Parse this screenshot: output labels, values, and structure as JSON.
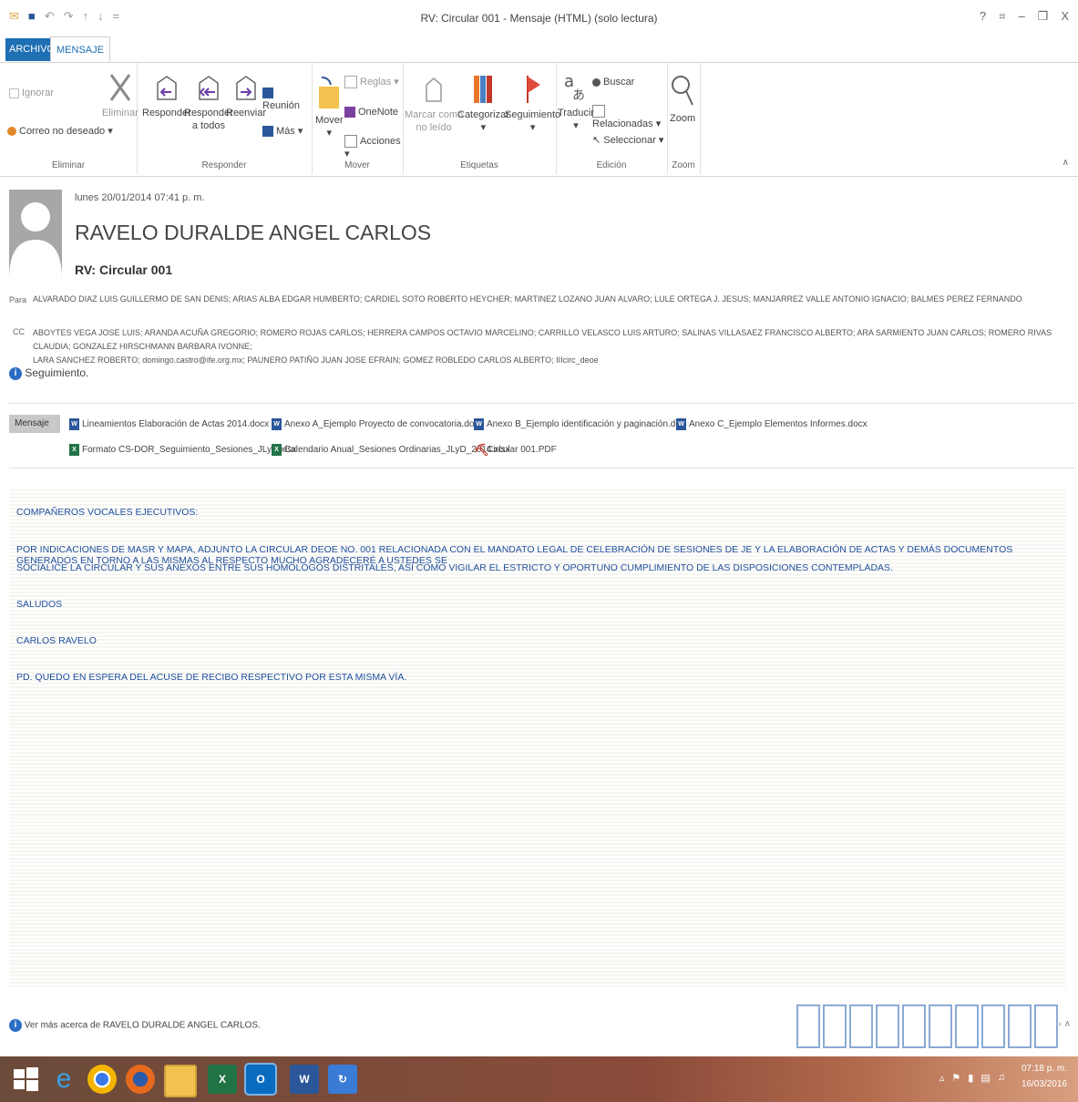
{
  "window": {
    "title": "RV: Circular 001 - Mensaje (HTML) (solo lectura)"
  },
  "qat": [
    "✉",
    "■",
    "↶",
    "↷",
    "↑",
    "↓",
    "="
  ],
  "winctl": [
    "?",
    "⌗",
    "–",
    "❐",
    "X"
  ],
  "tabs": {
    "archivo": "ARCHIVO",
    "mensaje": "MENSAJE"
  },
  "ribbon": {
    "groups": {
      "eliminar": "Eliminar",
      "responder": "Responder",
      "mover": "Mover",
      "etiquetas": "Etiquetas",
      "edicion": "Edición",
      "zoom": "Zoom"
    },
    "ignorar": "Ignorar",
    "correo_no_deseado": "Correo no deseado",
    "eliminar": "Eliminar",
    "responder": "Responder",
    "responder_todos_1": "Responder",
    "responder_todos_2": "a todos",
    "reenviar": "Reenviar",
    "reunion": "Reunión",
    "mas": "Más",
    "mover": "Mover",
    "reglas": "Reglas",
    "onenote": "OneNote",
    "acciones": "Acciones",
    "marcar_1": "Marcar como",
    "marcar_2": "no leído",
    "categorizar": "Categorizar",
    "seguimiento": "Seguimiento",
    "traducir": "Traducir",
    "buscar": "Buscar",
    "relacionadas": "Relacionadas",
    "seleccionar": "Seleccionar",
    "zoom": "Zoom"
  },
  "header": {
    "date": "lunes 20/01/2014 07:41 p. m.",
    "sender": "RAVELO DURALDE ANGEL CARLOS",
    "subject": "RV: Circular 001",
    "para_label": "Para",
    "para": "ALVARADO DIAZ LUIS GUILLERMO DE SAN DENIS; ARIAS ALBA EDGAR HUMBERTO; CARDIEL SOTO ROBERTO HEYCHER; MARTINEZ LOZANO JUAN ALVARO; LULE ORTEGA J. JESUS; MANJARREZ VALLE ANTONIO IGNACIO; BALMES PEREZ FERNANDO",
    "cc_label": "CC",
    "cc_1": "ABOYTES VEGA JOSE LUIS; ARANDA ACUÑA GREGORIO; ROMERO ROJAS CARLOS; HERRERA CAMPOS OCTAVIO MARCELINO; CARRILLO VELASCO LUIS ARTURO; SALINAS VILLASAEZ FRANCISCO ALBERTO; ARA SARMIENTO JUAN CARLOS; ROMERO RIVAS CLAUDIA; GONZALEZ HIRSCHMANN BARBARA IVONNE;",
    "cc_2": "LARA SANCHEZ ROBERTO; domingo.castro@ife.org.mx; PAUNERO PATIÑO JUAN JOSE EFRAIN; GOMEZ ROBLEDO CARLOS ALBERTO; IIIcirc_deoe",
    "seguimiento": "Seguimiento."
  },
  "attachments": {
    "mensaje": "Mensaje",
    "a1": "Lineamientos Elaboración de Actas 2014.docx",
    "a2": "Anexo A_Ejemplo Proyecto de convocatoria.docx",
    "a3": "Anexo B_Ejemplo identificación y paginación.doc",
    "a4": "Anexo C_Ejemplo Elementos Informes.docx",
    "a5": "Formato CS-DOR_Seguimiento_Sesiones_JLyD.xlsx",
    "a6": "Calendario Anual_Sesiones Ordinarias_JLyD_2014.xlsx",
    "a7": "Circular 001.PDF"
  },
  "body": {
    "greeting": "COMPAÑEROS VOCALES EJECUTIVOS:",
    "p1_line1": "POR INDICACIONES DE MASR Y MAPA, ADJUNTO LA CIRCULAR DEOE NO. 001 RELACIONADA CON EL MANDATO LEGAL DE CELEBRACIÓN DE SESIONES DE JE Y LA ELABORACIÓN DE ACTAS Y DEMÁS DOCUMENTOS GENERADOS EN TORNO A LAS MISMAS AL RESPECTO MUCHO AGRADECERÉ A USTEDES SE",
    "p1_line2": "SOCIALICE LA CIRCULAR Y SUS ANEXOS ENTRE SUS HOMÓLOGOS DISTRITALES, ASÍ COMO VIGILAR EL ESTRICTO Y OPORTUNO CUMPLIMIENTO DE LAS DISPOSICIONES CONTEMPLADAS.",
    "saludos": "SALUDOS",
    "firma": "CARLOS RAVELO",
    "pd": "PD. QUEDO EN ESPERA DEL ACUSE DE RECIBO RESPECTIVO POR ESTA MISMA VÍA."
  },
  "footer": {
    "info": "Ver más acerca de RAVELO DURALDE ANGEL CARLOS."
  },
  "taskbar": {
    "time": "07:18 p. m.",
    "date": "16/03/2016"
  }
}
